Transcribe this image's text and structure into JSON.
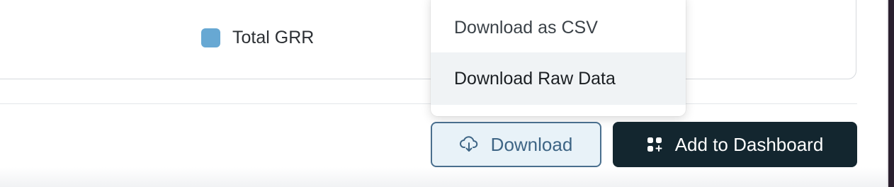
{
  "chart": {
    "legend": [
      {
        "label": "Total GRR",
        "color": "#67a8d3"
      }
    ]
  },
  "dropdown": {
    "items": [
      {
        "label": "Download as CSV",
        "highlighted": false
      },
      {
        "label": "Download Raw Data",
        "highlighted": true
      }
    ]
  },
  "actions": {
    "download": {
      "label": "Download",
      "icon": "cloud-download-icon"
    },
    "add_to_dashboard": {
      "label": "Add to Dashboard",
      "icon": "dashboard-add-icon"
    }
  },
  "colors": {
    "accent_dark": "#13262f",
    "download_border": "#4a6f8e",
    "download_bg": "#e8f2f8"
  }
}
